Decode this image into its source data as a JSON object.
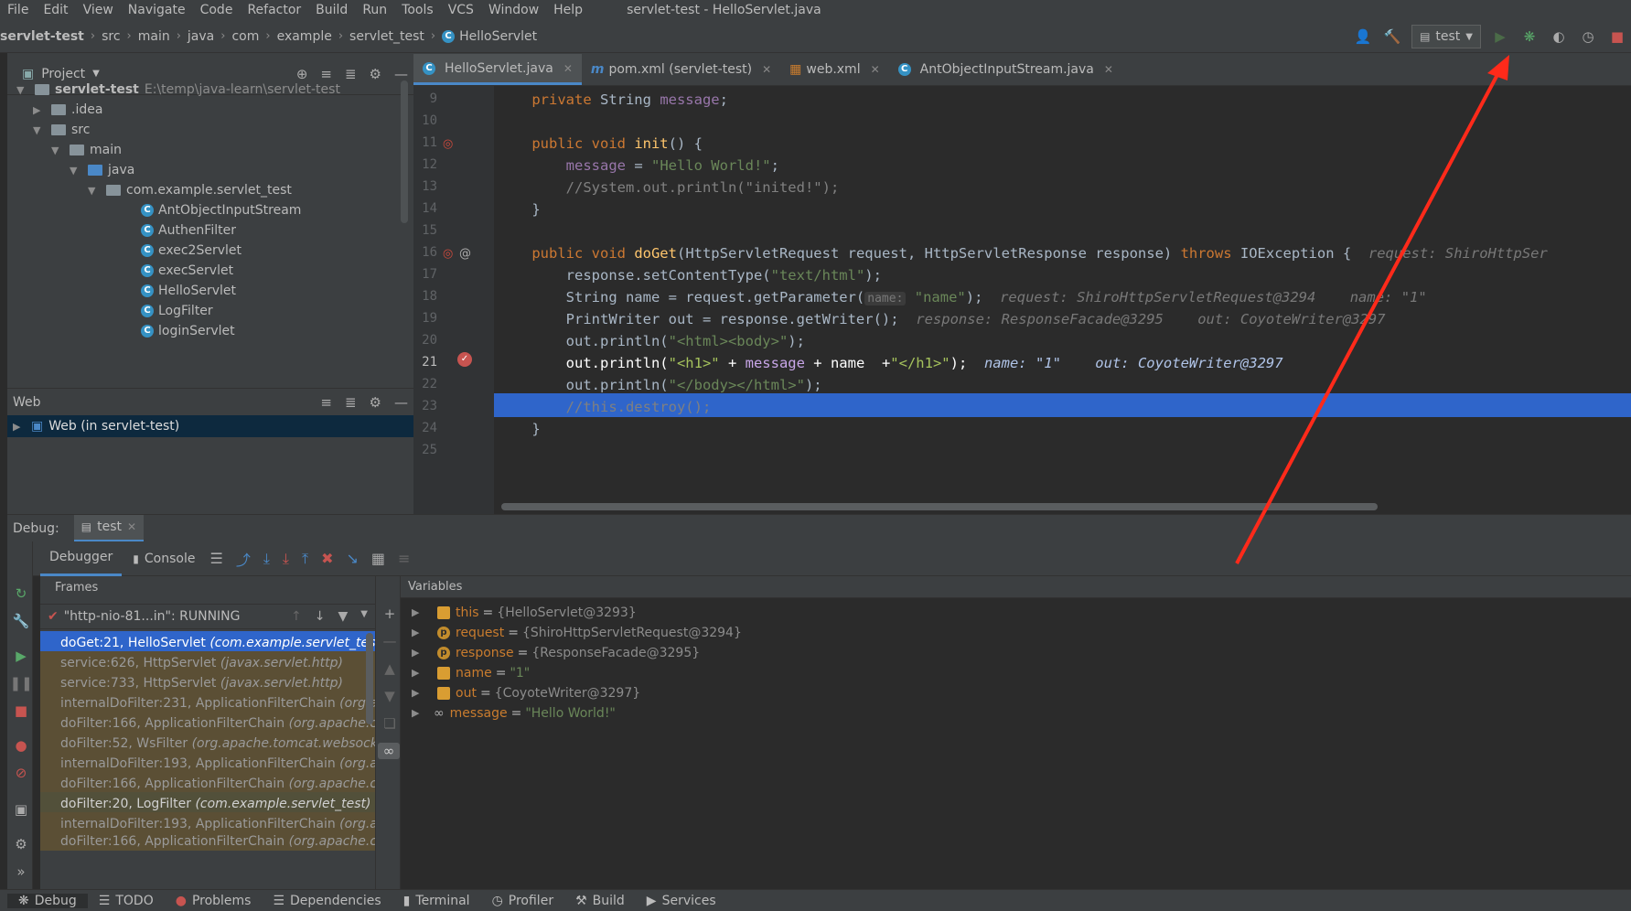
{
  "menu": [
    "File",
    "Edit",
    "View",
    "Navigate",
    "Code",
    "Refactor",
    "Build",
    "Run",
    "Tools",
    "VCS",
    "Window",
    "Help"
  ],
  "window_title": "servlet-test - HelloServlet.java",
  "breadcrumbs": [
    "servlet-test",
    "src",
    "main",
    "java",
    "com",
    "example",
    "servlet_test",
    "HelloServlet"
  ],
  "run_config": "test",
  "project_panel": {
    "title": "Project",
    "root_name": "servlet-test",
    "root_path": "E:\\temp\\java-learn\\servlet-test",
    "folders": [
      ".idea",
      "src",
      "main",
      "java",
      "com.example.servlet_test"
    ],
    "classes": [
      "AntObjectInputStream",
      "AuthenFilter",
      "exec2Servlet",
      "execServlet",
      "HelloServlet",
      "LogFilter",
      "loginServlet"
    ]
  },
  "web_panel": {
    "title": "Web",
    "item": "Web (in servlet-test)"
  },
  "editor_tabs": [
    "HelloServlet.java",
    "pom.xml (servlet-test)",
    "web.xml",
    "AntObjectInputStream.java"
  ],
  "editor": {
    "line_numbers": [
      "9",
      "10",
      "11",
      "12",
      "13",
      "14",
      "15",
      "16",
      "17",
      "18",
      "19",
      "20",
      "21",
      "22",
      "23",
      "24",
      "25"
    ],
    "hints": {
      "h16": "request: ShiroHttpSer",
      "h18a": "request: ShiroHttpServletRequest@3294",
      "h18b": "name: \"1\"",
      "h19a": "response: ResponseFacade@3295",
      "h19b": "out: CoyoteWriter@3297",
      "h21a": "name: \"1\"",
      "h21b": "out: CoyoteWriter@3297"
    }
  },
  "debug": {
    "label": "Debug:",
    "session_tab": "test",
    "tabs": {
      "debugger": "Debugger",
      "console": "Console"
    },
    "frames_title": "Frames",
    "thread": "\"http-nio-81...in\": RUNNING",
    "frames": [
      {
        "method": "doGet:21, HelloServlet",
        "pkg": "(com.example.servlet_test)"
      },
      {
        "method": "service:626, HttpServlet",
        "pkg": "(javax.servlet.http)"
      },
      {
        "method": "service:733, HttpServlet",
        "pkg": "(javax.servlet.http)"
      },
      {
        "method": "internalDoFilter:231, ApplicationFilterChain",
        "pkg": "(org.apa"
      },
      {
        "method": "doFilter:166, ApplicationFilterChain",
        "pkg": "(org.apache.cat"
      },
      {
        "method": "doFilter:52, WsFilter",
        "pkg": "(org.apache.tomcat.websocket."
      },
      {
        "method": "internalDoFilter:193, ApplicationFilterChain",
        "pkg": "(org.ap"
      },
      {
        "method": "doFilter:166, ApplicationFilterChain",
        "pkg": "(org.apache.cat"
      },
      {
        "method": "doFilter:20, LogFilter",
        "pkg": "(com.example.servlet_test)"
      },
      {
        "method": "internalDoFilter:193, ApplicationFilterChain",
        "pkg": "(org.ap"
      },
      {
        "method": "doFilter:166, ApplicationFilterChain",
        "pkg": "(org.apache.cat"
      }
    ],
    "variables_title": "Variables",
    "variables": [
      {
        "name": "this",
        "value": "{HelloServlet@3293}"
      },
      {
        "name": "request",
        "value": "{ShiroHttpServletRequest@3294}"
      },
      {
        "name": "response",
        "value": "{ResponseFacade@3295}"
      },
      {
        "name": "name",
        "value": "\"1\""
      },
      {
        "name": "out",
        "value": "{CoyoteWriter@3297}"
      },
      {
        "name": "message",
        "value": "\"Hello World!\""
      }
    ]
  },
  "statusbar": [
    "Debug",
    "TODO",
    "Problems",
    "Dependencies",
    "Terminal",
    "Profiler",
    "Build",
    "Services"
  ],
  "colors": {
    "accent": "#2f65ca",
    "annotation_arrow": "#ff2a1a"
  }
}
